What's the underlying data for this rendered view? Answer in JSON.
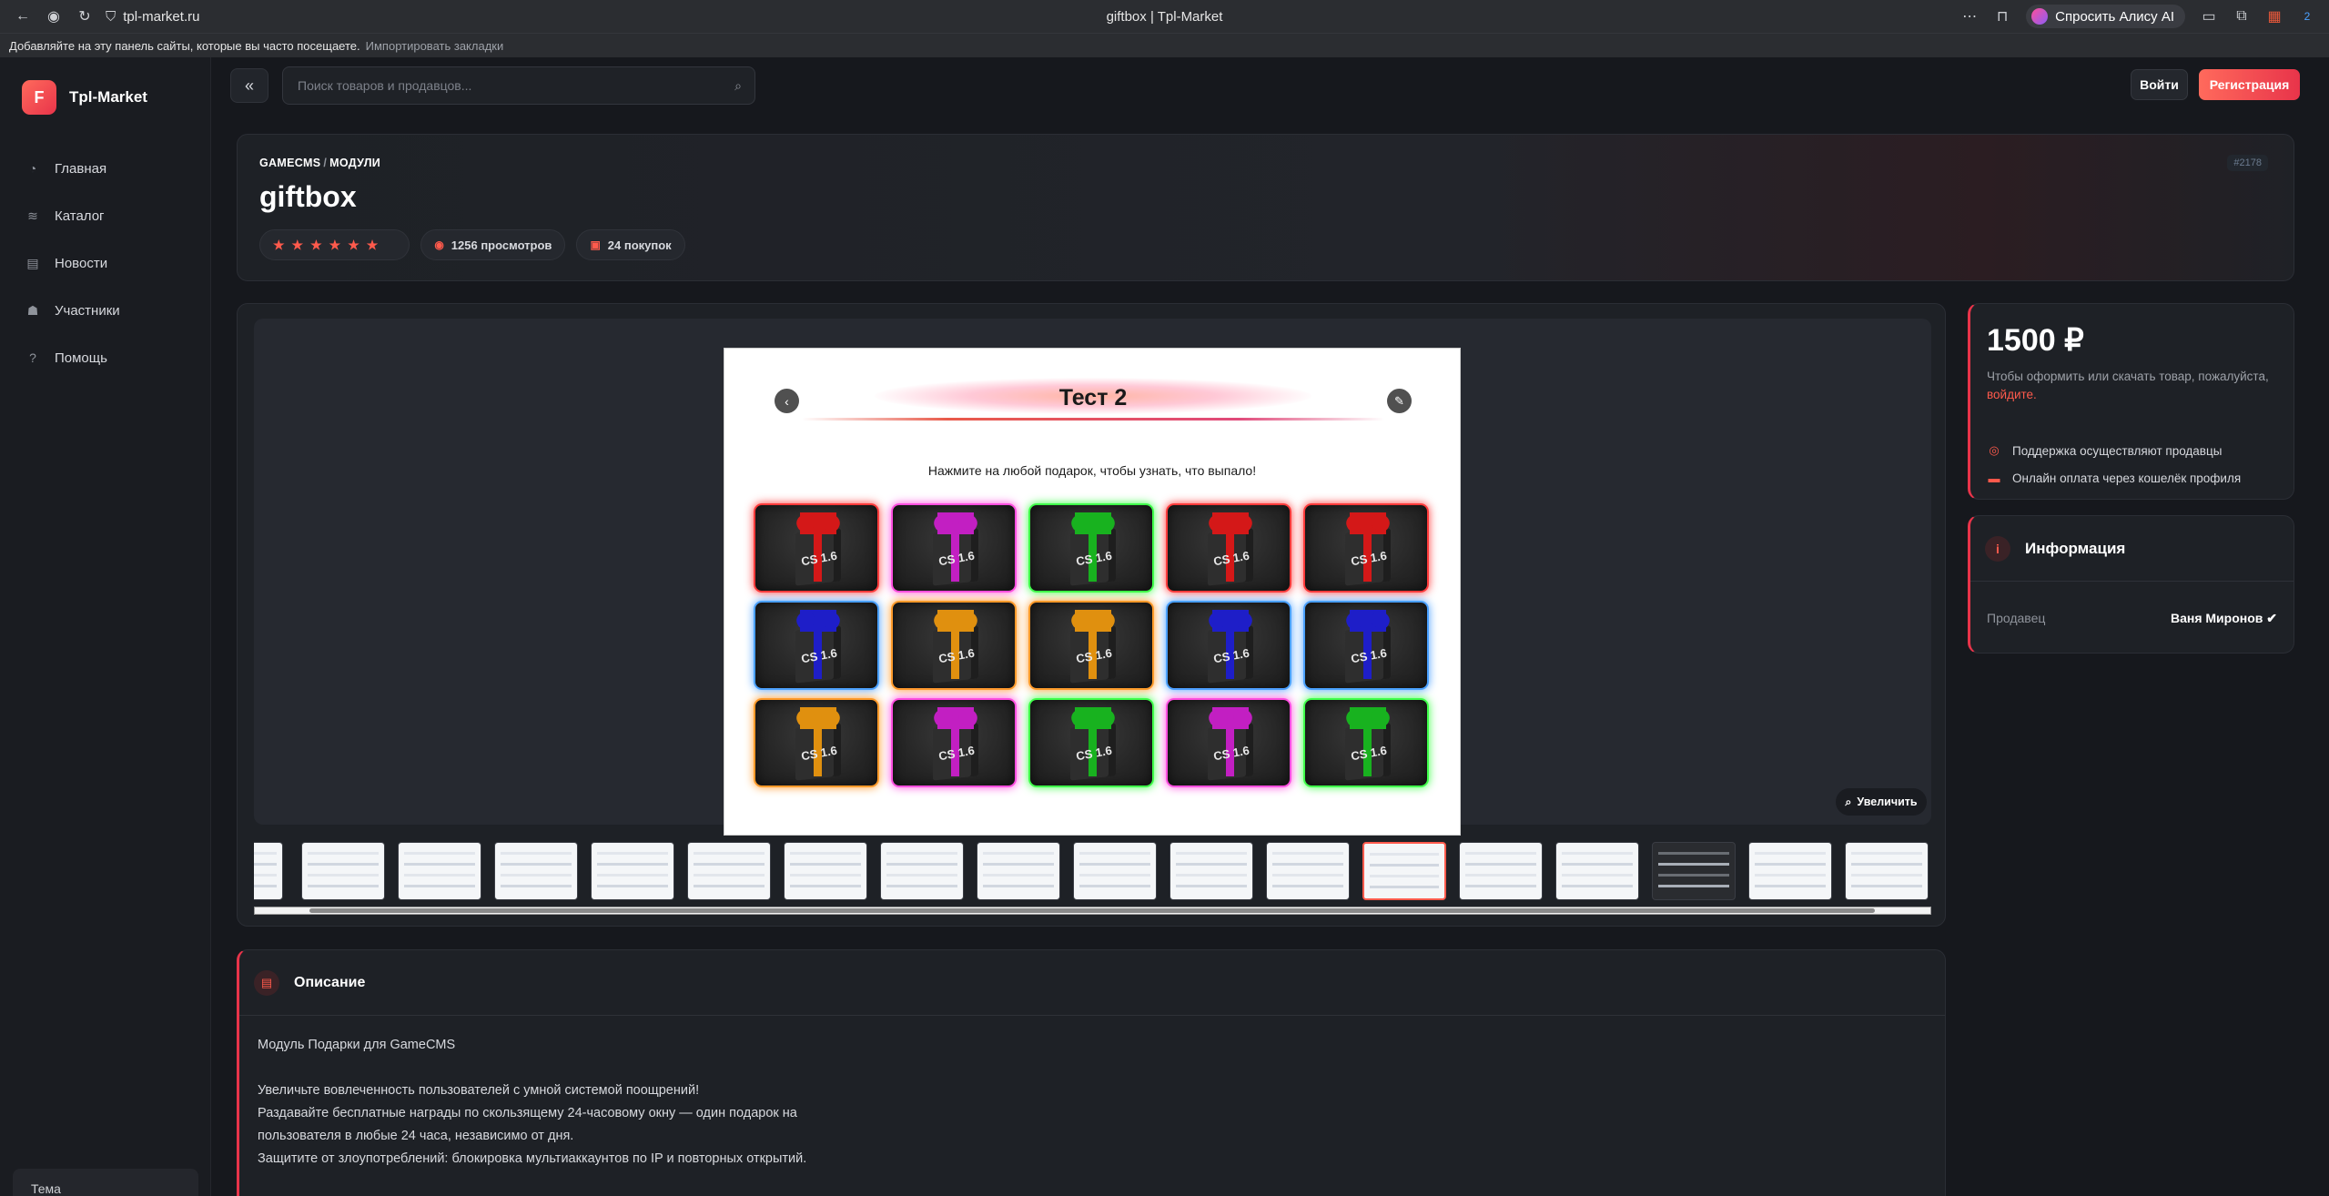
{
  "browser": {
    "url": "tpl-market.ru",
    "title": "giftbox | Tpl-Market",
    "alice_label": "Спросить Алису AI",
    "bookmarks_hint": "Добавляйте на эту панель сайты, которые вы часто посещаете.",
    "bookmarks_link": "Импортировать закладки",
    "badge_count": "2"
  },
  "sidebar": {
    "logo_letter": "F",
    "brand": "Tpl-Market",
    "items": [
      {
        "label": "Главная",
        "icon": "gauge-icon"
      },
      {
        "label": "Каталог",
        "icon": "layers-icon"
      },
      {
        "label": "Новости",
        "icon": "news-icon"
      },
      {
        "label": "Участники",
        "icon": "users-icon"
      },
      {
        "label": "Помощь",
        "icon": "help-icon"
      }
    ],
    "bottom_label": "Тема"
  },
  "topbar": {
    "search_placeholder": "Поиск товаров и продавцов...",
    "login": "Войти",
    "register": "Регистрация"
  },
  "product": {
    "crumb_1": "GAMECMS",
    "crumb_sep": "/",
    "crumb_2": "МОДУЛИ",
    "title": "giftbox",
    "id": "#2178",
    "stars": "★★★★★★",
    "views": "1256 просмотров",
    "purchases": "24 покупок"
  },
  "preview": {
    "title": "Тест 2",
    "subtitle": "Нажмите на любой подарок, чтобы узнать, что выпало!",
    "gift_label": "CS 1.6",
    "gifts": [
      {
        "ribbon": "#d41818",
        "glow": "#ff3b3b"
      },
      {
        "ribbon": "#c21fc2",
        "glow": "#ff4fe0"
      },
      {
        "ribbon": "#18b21f",
        "glow": "#3fff4a"
      },
      {
        "ribbon": "#d41818",
        "glow": "#ff3b3b"
      },
      {
        "ribbon": "#d41818",
        "glow": "#ff3b3b"
      },
      {
        "ribbon": "#1e1ec8",
        "glow": "#4aa0ff"
      },
      {
        "ribbon": "#e0900f",
        "glow": "#ff9a2a"
      },
      {
        "ribbon": "#e0900f",
        "glow": "#ff9a2a"
      },
      {
        "ribbon": "#1e1ec8",
        "glow": "#4aa0ff"
      },
      {
        "ribbon": "#1e1ec8",
        "glow": "#4aa0ff"
      },
      {
        "ribbon": "#e0900f",
        "glow": "#ff9a2a"
      },
      {
        "ribbon": "#c21fc2",
        "glow": "#ff4fe0"
      },
      {
        "ribbon": "#18b21f",
        "glow": "#3fff4a"
      },
      {
        "ribbon": "#c21fc2",
        "glow": "#ff4fe0"
      },
      {
        "ribbon": "#18b21f",
        "glow": "#3fff4a"
      }
    ],
    "zoom_label": "Увеличить",
    "thumbnail_count": 18,
    "active_thumbnail": 12,
    "dark_thumbnails": [
      15
    ]
  },
  "purchase": {
    "price": "1500 ₽",
    "note": "Чтобы оформить или скачать товар, пожалуйста,",
    "login_link": "войдите.",
    "feature_1": "Поддержка осуществляют продавцы",
    "feature_2": "Онлайн оплата через кошелёк профиля"
  },
  "info": {
    "title": "Информация",
    "seller_label": "Продавец",
    "seller_name": "Ваня Миронов"
  },
  "description": {
    "title": "Описание",
    "lines": [
      "Модуль Подарки для GameCMS",
      "",
      "Увеличьте вовлеченность пользователей с умной системой поощрений!",
      "Раздавайте бесплатные награды по скользящему 24-часовому окну — один подарок на",
      "пользователя в любые 24 часа, независимо от дня.",
      "Защитите от злоупотреблений: блокировка мультиаккаунтов по IP и повторных открытий."
    ]
  },
  "colors": {
    "accent": "#ff5a4c",
    "accent_dark": "#e8344a",
    "background": "#16181d",
    "card": "#1e2126"
  }
}
